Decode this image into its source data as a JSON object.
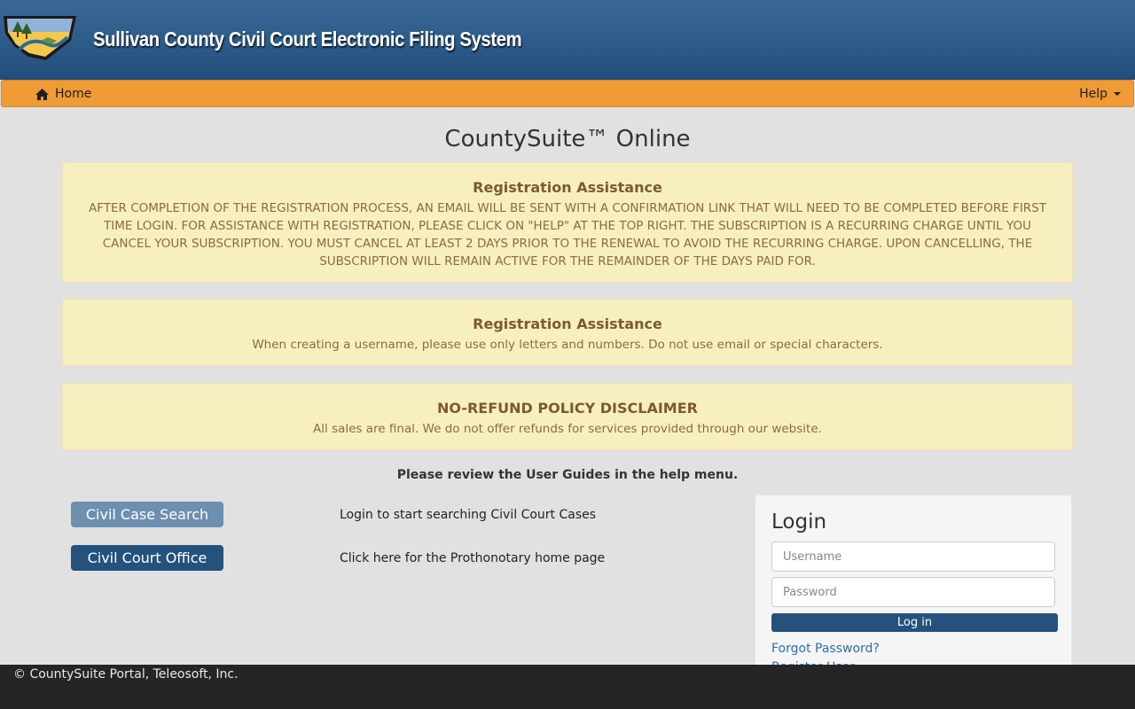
{
  "header": {
    "title": "Sullivan County Civil Court Electronic Filing System",
    "logo_icon": "county-seal-logo"
  },
  "nav": {
    "home_label": "Home",
    "home_icon": "home-icon",
    "help_label": "Help",
    "help_icon": "caret-down-icon"
  },
  "page_title": "CountySuite™ Online",
  "notices": [
    {
      "title": "Registration Assistance",
      "body": "AFTER COMPLETION OF THE REGISTRATION PROCESS, AN EMAIL WILL BE SENT WITH A CONFIRMATION LINK THAT WILL NEED TO BE COMPLETED BEFORE FIRST TIME LOGIN. FOR ASSISTANCE WITH REGISTRATION, PLEASE CLICK ON \"HELP\" AT THE TOP RIGHT. THE SUBSCRIPTION IS A RECURRING CHARGE UNTIL YOU CANCEL YOUR SUBSCRIPTION. YOU MUST CANCEL AT LEAST 2 DAYS PRIOR TO THE RENEWAL TO AVOID THE RECURRING CHARGE. UPON CANCELLING, THE SUBSCRIPTION WILL REMAIN ACTIVE FOR THE REMAINDER OF THE DAYS PAID FOR."
    },
    {
      "title": "Registration Assistance",
      "body": "When creating a username, please use only letters and numbers. Do not use email or special characters."
    },
    {
      "title": "NO-REFUND POLICY DISCLAIMER",
      "body": "All sales are final. We do not offer refunds for services provided through our website."
    }
  ],
  "review_note": "Please review the User Guides in the help menu.",
  "actions": [
    {
      "label": "Civil Case Search",
      "description": "Login to start searching Civil Court Cases"
    },
    {
      "label": "Civil Court Office",
      "description": "Click here for the Prothonotary home page"
    }
  ],
  "login": {
    "title": "Login",
    "username_placeholder": "Username",
    "username_value": "",
    "password_placeholder": "Password",
    "password_value": "",
    "button_label": "Log in",
    "forgot_link": "Forgot Password?",
    "register_link": "Register User"
  },
  "footer": {
    "text": "© CountySuite Portal, Teleosoft, Inc."
  },
  "colors": {
    "header": "#2c5a88",
    "navbar": "#ef9b36",
    "notice_bg": "#f8efc0",
    "notice_text": "#8a6d3b",
    "primary_button": "#24527d",
    "secondary_button": "#6d8fb0",
    "footer": "#252525"
  }
}
